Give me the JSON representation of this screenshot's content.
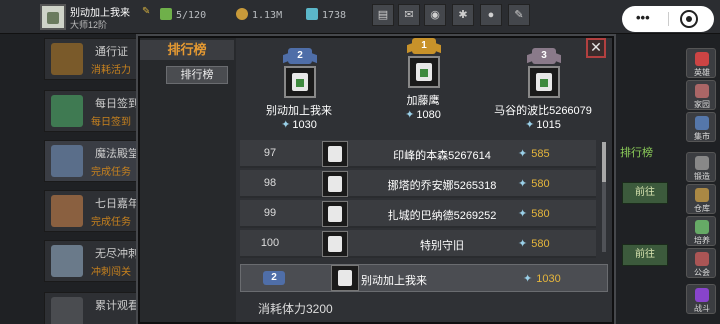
{
  "player": {
    "name": "别动加上我来",
    "rank": "大师12阶"
  },
  "resources": {
    "stamina": "5/120",
    "gold": "1.13M",
    "gems": "1738"
  },
  "top_buttons": [
    "shop-icon",
    "mail-icon",
    "gamepad-icon",
    "settings-icon",
    "social-icon",
    "edit-icon"
  ],
  "background_list": [
    {
      "title": "通行证",
      "subtitle": "消耗活力"
    },
    {
      "title": "每日签到",
      "subtitle": "每日签到"
    },
    {
      "title": "魔法殿堂",
      "subtitle": "完成任务"
    },
    {
      "title": "七日嘉年",
      "subtitle": "完成任务"
    },
    {
      "title": "无尽冲刺",
      "subtitle": "冲刺闯关"
    },
    {
      "title": "累计观看广告",
      "subtitle": ""
    }
  ],
  "right_tab_label": "排行榜",
  "right_buttons": [
    "前往",
    "前往"
  ],
  "side_menu": [
    "英雄",
    "家园",
    "集市",
    "锻造",
    "仓库",
    "培养",
    "公会",
    "战斗"
  ],
  "modal": {
    "title": "排行榜",
    "sub_tab": "排行榜",
    "close": "✕",
    "podium": [
      {
        "rank": "2",
        "name": "别动加上我来",
        "power": "1030",
        "color": "#4f6ea8"
      },
      {
        "rank": "1",
        "name": "加藤鹰",
        "power": "1080",
        "color": "#c8922a"
      },
      {
        "rank": "3",
        "name": "马谷的波比5266079",
        "power": "1015",
        "color": "#8a7a8a"
      }
    ],
    "rows": [
      {
        "no": "97",
        "name": "印峰的本森5267614",
        "power": "585"
      },
      {
        "no": "98",
        "name": "挪塔的乔安娜5265318",
        "power": "580"
      },
      {
        "no": "99",
        "name": "扎城的巴纳德5269252",
        "power": "580"
      },
      {
        "no": "100",
        "name": "特别守旧",
        "power": "580"
      }
    ],
    "self": {
      "rank": "2",
      "name": "别动加上我来",
      "power": "1030"
    },
    "footer": "消耗体力3200"
  }
}
